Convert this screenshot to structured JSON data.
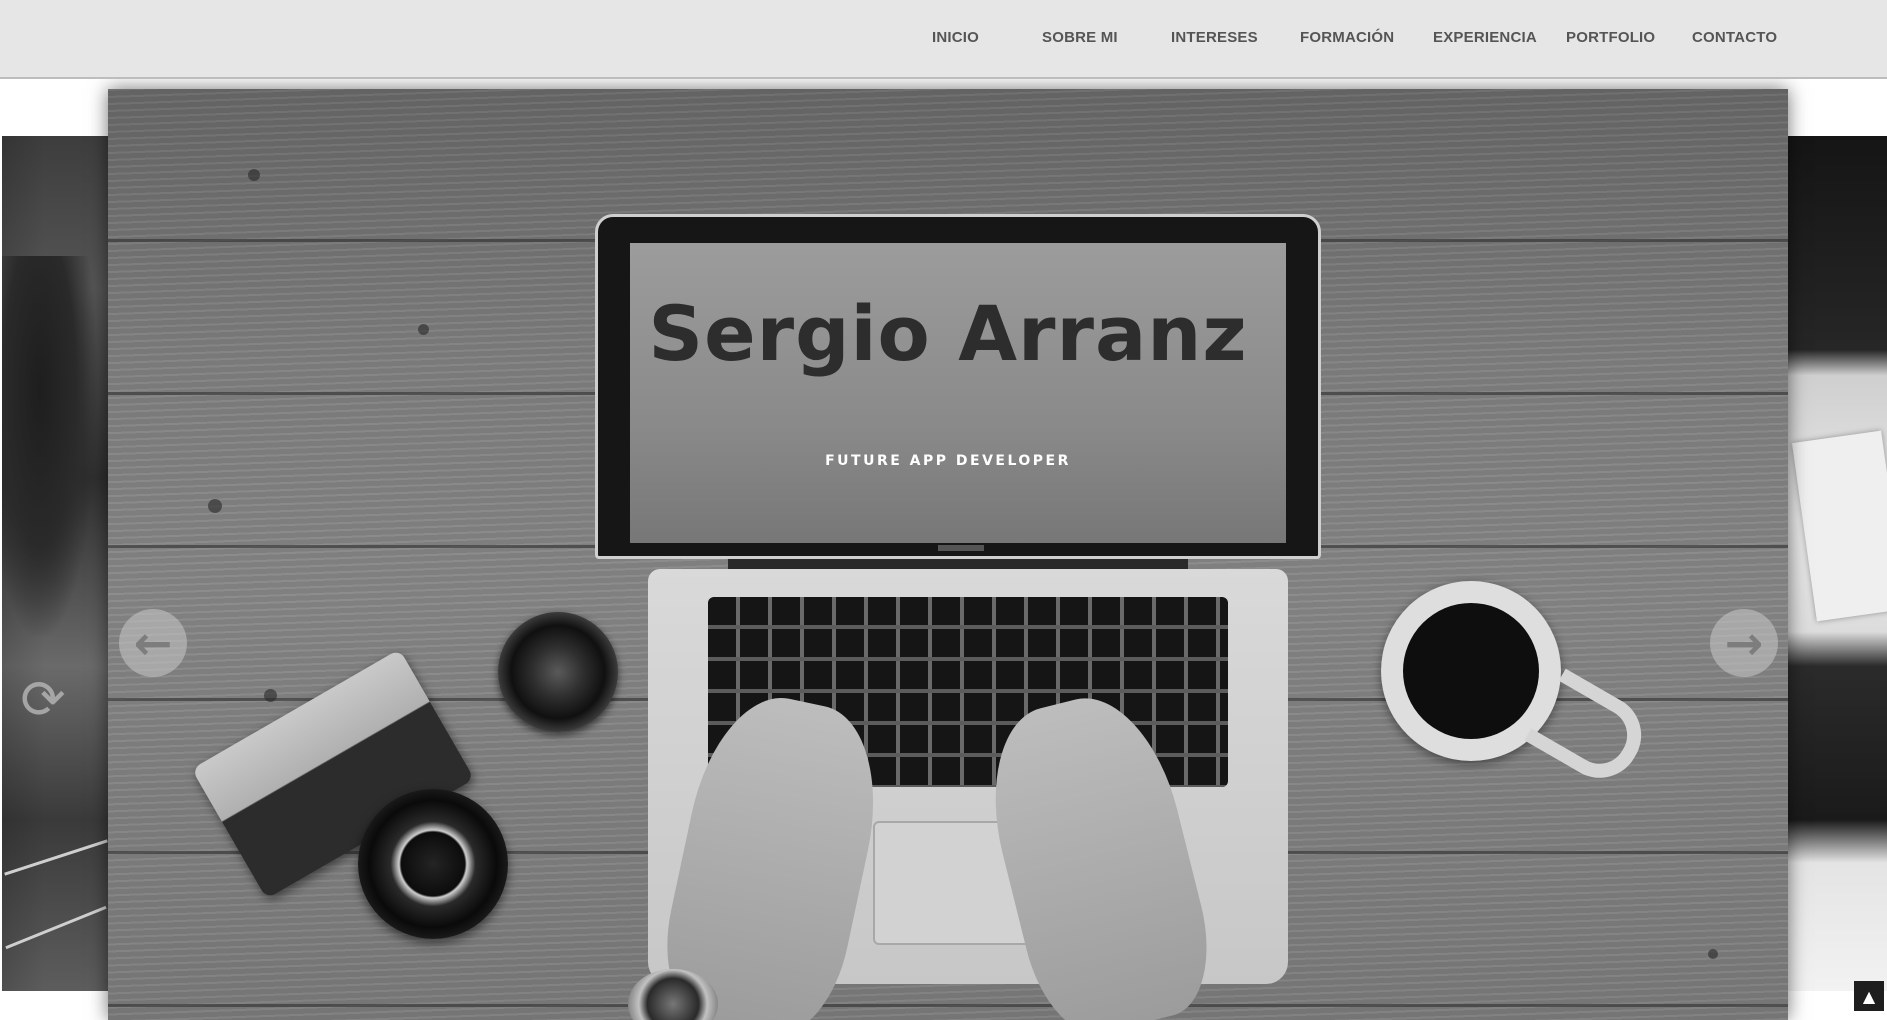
{
  "nav": {
    "items": [
      {
        "label": "INICIO"
      },
      {
        "label": "SOBRE MI"
      },
      {
        "label": "INTERESES"
      },
      {
        "label": "FORMACIÓN"
      },
      {
        "label": "EXPERIENCIA"
      },
      {
        "label": "PORTFOLIO"
      },
      {
        "label": "CONTACTO"
      }
    ]
  },
  "hero": {
    "title": "Sergio Arranz",
    "subtitle": "FUTURE APP DEVELOPER"
  },
  "carousel": {
    "prev_icon": "arrow-left-circle-icon",
    "next_icon": "arrow-right-circle-icon"
  },
  "back_to_top": {
    "icon": "chevron-up-icon"
  },
  "colors": {
    "navbar_bg": "#e6e6e6",
    "nav_text": "#555555",
    "title_text": "#2d2d2d",
    "subtitle_text": "#ffffff"
  }
}
